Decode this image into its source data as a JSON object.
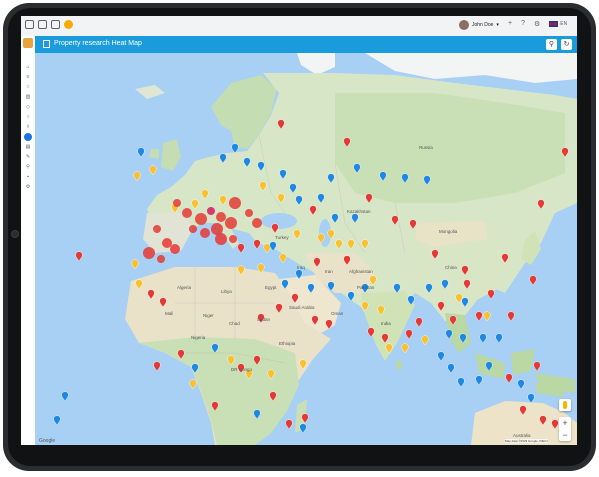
{
  "topbar": {
    "username": "John Doe",
    "language": "EN"
  },
  "header": {
    "title": "Property research Heat Map"
  },
  "map": {
    "labels": {
      "russia": "Russia",
      "kazakhstan": "Kazakhstan",
      "mongolia": "Mongolia",
      "china": "China",
      "india": "India",
      "afghanistan": "Afghanistan",
      "pakistan": "Pakistan",
      "iran": "Iran",
      "iraq": "Iraq",
      "saudi": "Saudi Arabia",
      "egypt": "Egypt",
      "algeria": "Algeria",
      "libya": "Libya",
      "mali": "Mali",
      "niger": "Niger",
      "chad": "Chad",
      "sudan": "Sudan",
      "ethiopia": "Ethiopia",
      "nigeria": "Nigeria",
      "drc": "DR Congo",
      "australia": "Australia",
      "turkey": "Turkey",
      "oman": "Oman"
    },
    "attribution": "Map data ©2023 Google, INEGI",
    "google": "Google",
    "zoom_in": "+",
    "zoom_out": "−"
  },
  "colors": {
    "red": "#e53935",
    "yellow": "#fbc02d",
    "blue": "#1e88e5",
    "magenta": "#d81b60",
    "header": "#1a9bdc"
  }
}
